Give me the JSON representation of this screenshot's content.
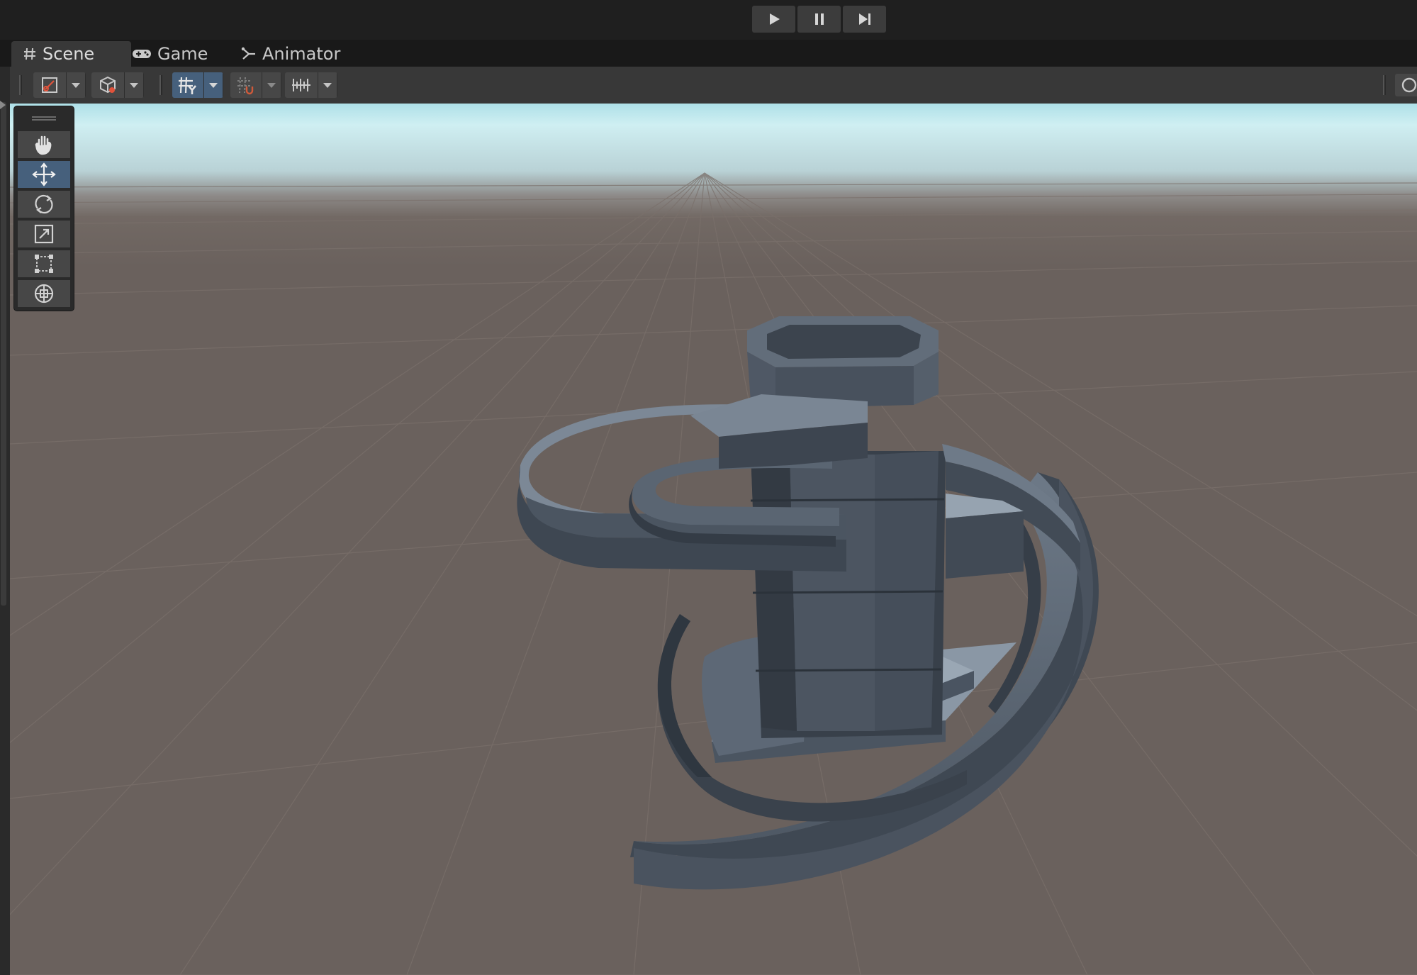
{
  "playbar": {
    "play_icon": "play-icon",
    "pause_icon": "pause-icon",
    "step_icon": "step-icon"
  },
  "tabs": [
    {
      "label": "Scene",
      "icon": "grid-icon",
      "active": true
    },
    {
      "label": "Game",
      "icon": "gamepad-icon",
      "active": false
    },
    {
      "label": "Animator",
      "icon": "animator-icon",
      "active": false
    }
  ],
  "toolbar": {
    "items": [
      {
        "icon": "draw-mode-icon"
      },
      {
        "icon": "shading-mode-icon"
      },
      {
        "icon": "grid-snap-icon",
        "active": true
      },
      {
        "icon": "snap-increment-icon"
      },
      {
        "icon": "ruler-icon"
      }
    ]
  },
  "tools": [
    {
      "name": "hand-tool",
      "icon": "hand-icon",
      "active": false
    },
    {
      "name": "move-tool",
      "icon": "move-icon",
      "active": true
    },
    {
      "name": "rotate-tool",
      "icon": "rotate-icon",
      "active": false
    },
    {
      "name": "scale-tool",
      "icon": "scale-icon",
      "active": false
    },
    {
      "name": "rect-tool",
      "icon": "rect-icon",
      "active": false
    },
    {
      "name": "transform-tool",
      "icon": "transform-icon",
      "active": false
    }
  ],
  "colors": {
    "active": "#46607c",
    "panel": "#383838",
    "ground": "#6a615d",
    "sky": "#cfeff2",
    "model": "#4f5864"
  }
}
